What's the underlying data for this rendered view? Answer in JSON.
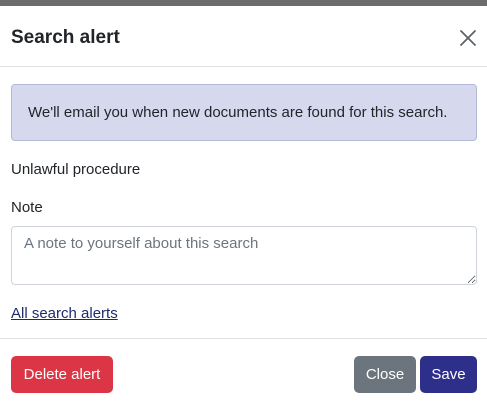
{
  "modal": {
    "title": "Search alert",
    "close_icon": "close-icon"
  },
  "info": {
    "text": "We'll email you when new documents are found for this search."
  },
  "search": {
    "name": "Unlawful procedure"
  },
  "note": {
    "label": "Note",
    "value": "",
    "placeholder": "A note to yourself about this search"
  },
  "links": {
    "all_alerts": "All search alerts"
  },
  "footer": {
    "delete_label": "Delete alert",
    "close_label": "Close",
    "save_label": "Save"
  },
  "colors": {
    "danger": "#dc3545",
    "secondary": "#6c757d",
    "primary": "#2e2f8a",
    "info_bg": "#d6d8ee",
    "link": "#1d2a6e"
  }
}
